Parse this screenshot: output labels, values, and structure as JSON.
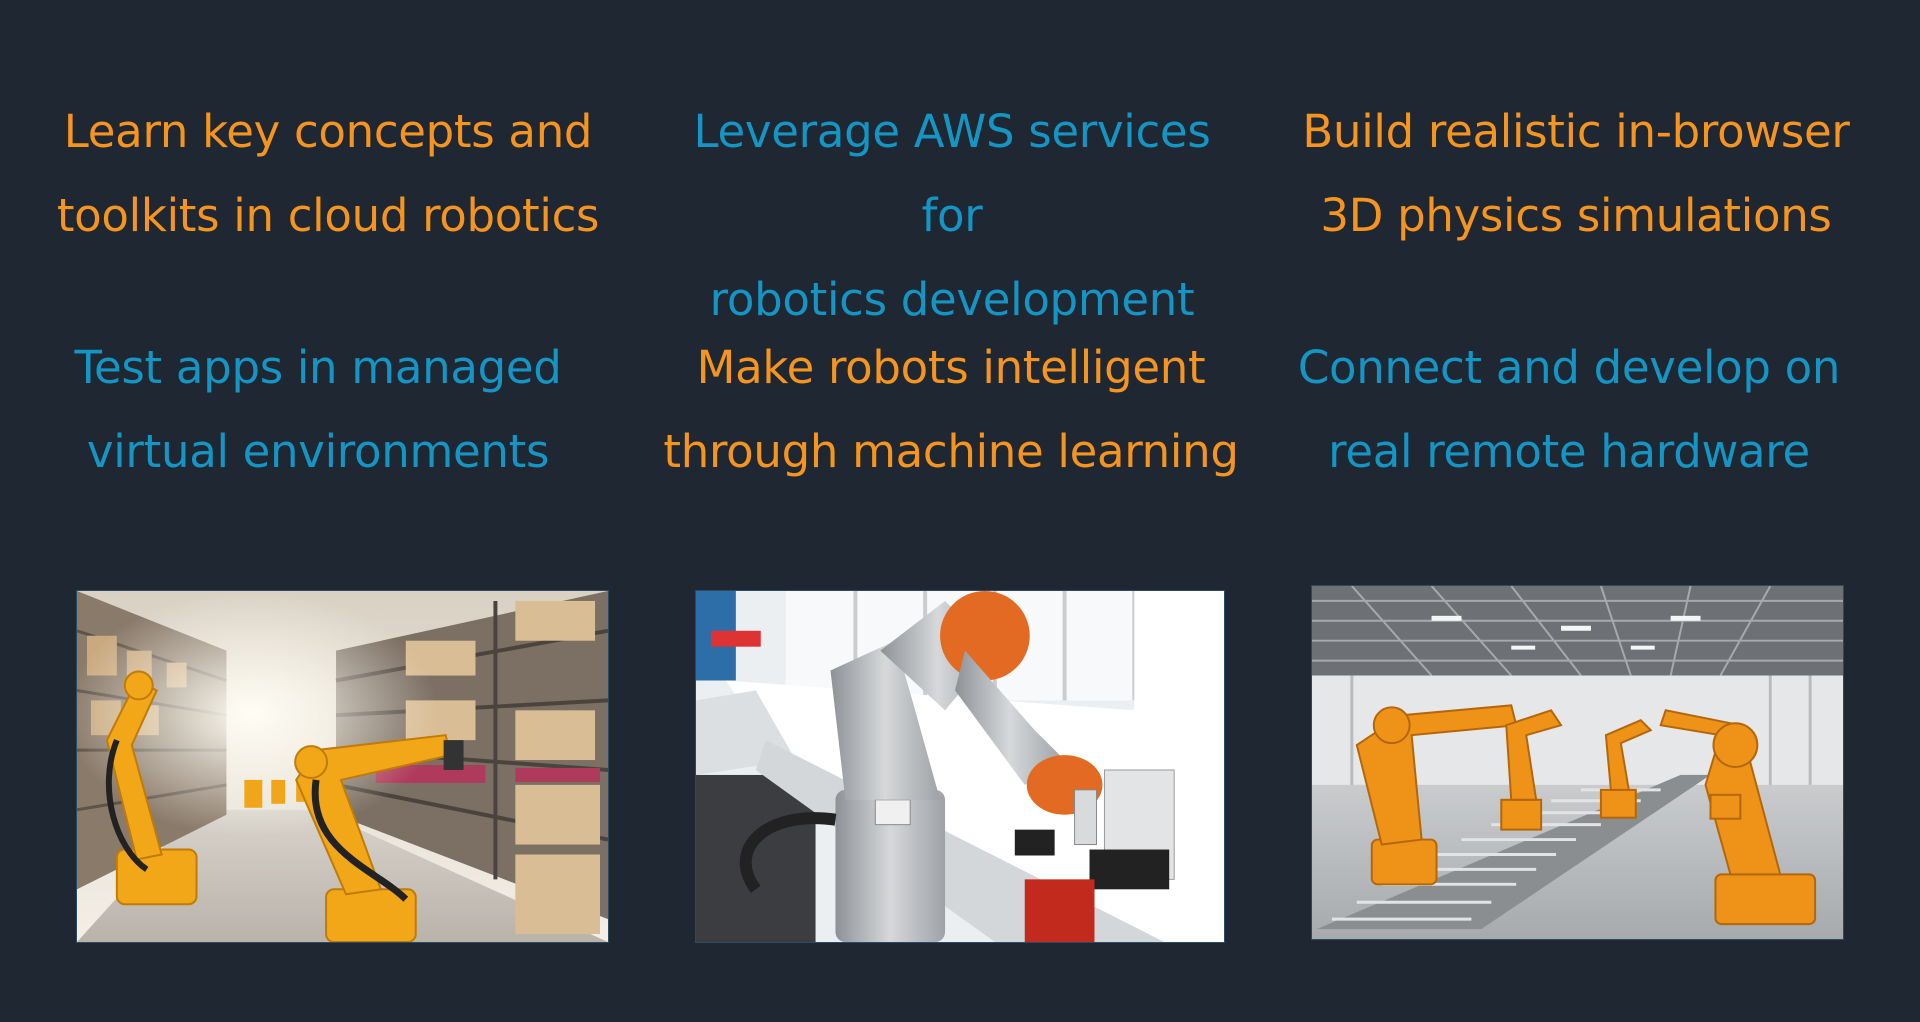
{
  "features": [
    {
      "line1": "Learn key concepts and",
      "line2": "toolkits in cloud robotics"
    },
    {
      "line1": "Leverage AWS services for",
      "line2": "robotics development"
    },
    {
      "line1": "Build realistic in-browser",
      "line2": "3D physics simulations"
    },
    {
      "line1": "Test apps in managed",
      "line2": "virtual environments"
    },
    {
      "line1": "Make robots intelligent",
      "line2": "through machine learning"
    },
    {
      "line1": "Connect and develop on",
      "line2": "real remote hardware"
    }
  ],
  "colors": {
    "background": "#1f2733",
    "accent_orange": "#f5941e",
    "accent_blue": "#1495c4"
  },
  "images": [
    {
      "name": "warehouse-robot-arms-photo"
    },
    {
      "name": "lab-robot-arm-photo"
    },
    {
      "name": "factory-robot-arms-conveyor-photo"
    }
  ]
}
